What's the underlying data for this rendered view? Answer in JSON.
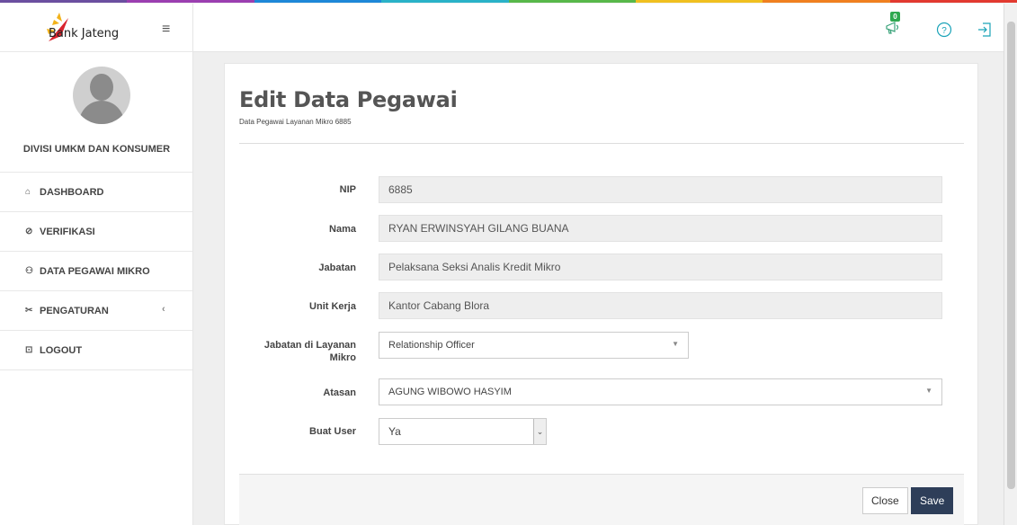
{
  "brand": {
    "name": "Bank Jateng",
    "menu_toggle": "≡"
  },
  "profile": {
    "division": "DIVISI UMKM DAN KONSUMER"
  },
  "sidebar": {
    "items": [
      {
        "icon": "home-icon",
        "glyph": "⌂",
        "label": "DASHBOARD"
      },
      {
        "icon": "check-circle-icon",
        "glyph": "⊘",
        "label": "VERIFIKASI"
      },
      {
        "icon": "users-icon",
        "glyph": "⚇",
        "label": "DATA PEGAWAI MIKRO"
      },
      {
        "icon": "wrench-icon",
        "glyph": "✂",
        "label": "PENGATURAN",
        "chevron": "‹"
      },
      {
        "icon": "logout-icon",
        "glyph": "⊡",
        "label": "LOGOUT"
      }
    ]
  },
  "topbar": {
    "notification_count": "0",
    "help_glyph": "?",
    "icons": [
      "megaphone-icon",
      "help-icon",
      "sign-out-icon"
    ]
  },
  "form": {
    "title": "Edit Data Pegawai",
    "subtitle": "Data Pegawai Layanan Mikro 6885",
    "fields": {
      "nip": {
        "label": "NIP",
        "value": "6885"
      },
      "nama": {
        "label": "Nama",
        "value": "RYAN ERWINSYAH GILANG BUANA"
      },
      "jabatan": {
        "label": "Jabatan",
        "value": "Pelaksana Seksi Analis Kredit Mikro"
      },
      "unit_kerja": {
        "label": "Unit Kerja",
        "value": "Kantor Cabang Blora"
      },
      "jabatan_layanan": {
        "label_line1": "Jabatan di Layanan",
        "label_line2": "Mikro",
        "value": "Relationship Officer"
      },
      "atasan": {
        "label": "Atasan",
        "value": "AGUNG WIBOWO HASYIM"
      },
      "buat_user": {
        "label": "Buat User",
        "value": "Ya"
      }
    },
    "buttons": {
      "close": "Close",
      "save": "Save"
    }
  },
  "colors": {
    "accent": "#2e3e59",
    "badge": "#2fa84f",
    "strip": [
      "#6b4fa0",
      "#9b3fb0",
      "#1e88d8",
      "#2ab2c8",
      "#58b84a",
      "#f0c020",
      "#f08020",
      "#e23a30"
    ]
  }
}
